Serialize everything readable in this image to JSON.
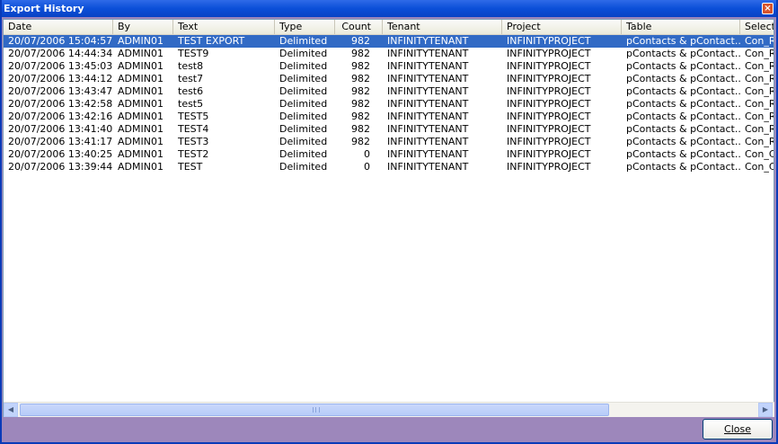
{
  "window": {
    "title": "Export History",
    "close_glyph": "×"
  },
  "columns": [
    {
      "label": "Date"
    },
    {
      "label": "By"
    },
    {
      "label": "Text"
    },
    {
      "label": "Type"
    },
    {
      "label": "Count"
    },
    {
      "label": "Tenant"
    },
    {
      "label": "Project"
    },
    {
      "label": "Table"
    },
    {
      "label": "Selectio"
    }
  ],
  "rows": [
    {
      "date": "20/07/2006 15:04:57",
      "by": "ADMIN01",
      "text": "TEST EXPORT",
      "type": "Delimited",
      "count": "982",
      "tenant": "INFINITYTENANT",
      "project": "INFINITYPROJECT",
      "table": "pContacts & pContact...",
      "selection": "Con_Re",
      "selected": true
    },
    {
      "date": "20/07/2006 14:44:34",
      "by": "ADMIN01",
      "text": "TEST9",
      "type": "Delimited",
      "count": "982",
      "tenant": "INFINITYTENANT",
      "project": "INFINITYPROJECT",
      "table": "pContacts & pContact...",
      "selection": "Con_Re",
      "selected": false
    },
    {
      "date": "20/07/2006 13:45:03",
      "by": "ADMIN01",
      "text": "test8",
      "type": "Delimited",
      "count": "982",
      "tenant": "INFINITYTENANT",
      "project": "INFINITYPROJECT",
      "table": "pContacts & pContact...",
      "selection": "Con_Re",
      "selected": false
    },
    {
      "date": "20/07/2006 13:44:12",
      "by": "ADMIN01",
      "text": "test7",
      "type": "Delimited",
      "count": "982",
      "tenant": "INFINITYTENANT",
      "project": "INFINITYPROJECT",
      "table": "pContacts & pContact...",
      "selection": "Con_Re",
      "selected": false
    },
    {
      "date": "20/07/2006 13:43:47",
      "by": "ADMIN01",
      "text": "test6",
      "type": "Delimited",
      "count": "982",
      "tenant": "INFINITYTENANT",
      "project": "INFINITYPROJECT",
      "table": "pContacts & pContact...",
      "selection": "Con_Re",
      "selected": false
    },
    {
      "date": "20/07/2006 13:42:58",
      "by": "ADMIN01",
      "text": "test5",
      "type": "Delimited",
      "count": "982",
      "tenant": "INFINITYTENANT",
      "project": "INFINITYPROJECT",
      "table": "pContacts & pContact...",
      "selection": "Con_Re",
      "selected": false
    },
    {
      "date": "20/07/2006 13:42:16",
      "by": "ADMIN01",
      "text": "TEST5",
      "type": "Delimited",
      "count": "982",
      "tenant": "INFINITYTENANT",
      "project": "INFINITYPROJECT",
      "table": "pContacts & pContact...",
      "selection": "Con_Re",
      "selected": false
    },
    {
      "date": "20/07/2006 13:41:40",
      "by": "ADMIN01",
      "text": "TEST4",
      "type": "Delimited",
      "count": "982",
      "tenant": "INFINITYTENANT",
      "project": "INFINITYPROJECT",
      "table": "pContacts & pContact...",
      "selection": "Con_Re",
      "selected": false
    },
    {
      "date": "20/07/2006 13:41:17",
      "by": "ADMIN01",
      "text": "TEST3",
      "type": "Delimited",
      "count": "982",
      "tenant": "INFINITYTENANT",
      "project": "INFINITYPROJECT",
      "table": "pContacts & pContact...",
      "selection": "Con_Re",
      "selected": false
    },
    {
      "date": "20/07/2006 13:40:25",
      "by": "ADMIN01",
      "text": "TEST2",
      "type": "Delimited",
      "count": "0",
      "tenant": "INFINITYTENANT",
      "project": "INFINITYPROJECT",
      "table": "pContacts & pContact...",
      "selection": "Con_Ca",
      "selected": false
    },
    {
      "date": "20/07/2006 13:39:44",
      "by": "ADMIN01",
      "text": "TEST",
      "type": "Delimited",
      "count": "0",
      "tenant": "INFINITYTENANT",
      "project": "INFINITYPROJECT",
      "table": "pContacts & pContact...",
      "selection": "Con_Ca",
      "selected": false
    }
  ],
  "scrollbar": {
    "left_arrow": "◀",
    "right_arrow": "▶"
  },
  "footer": {
    "close_label": "Close"
  },
  "colors": {
    "title_bar": "#0b4fd8",
    "selection": "#316ac5",
    "footer_bg": "#9d87bb"
  }
}
